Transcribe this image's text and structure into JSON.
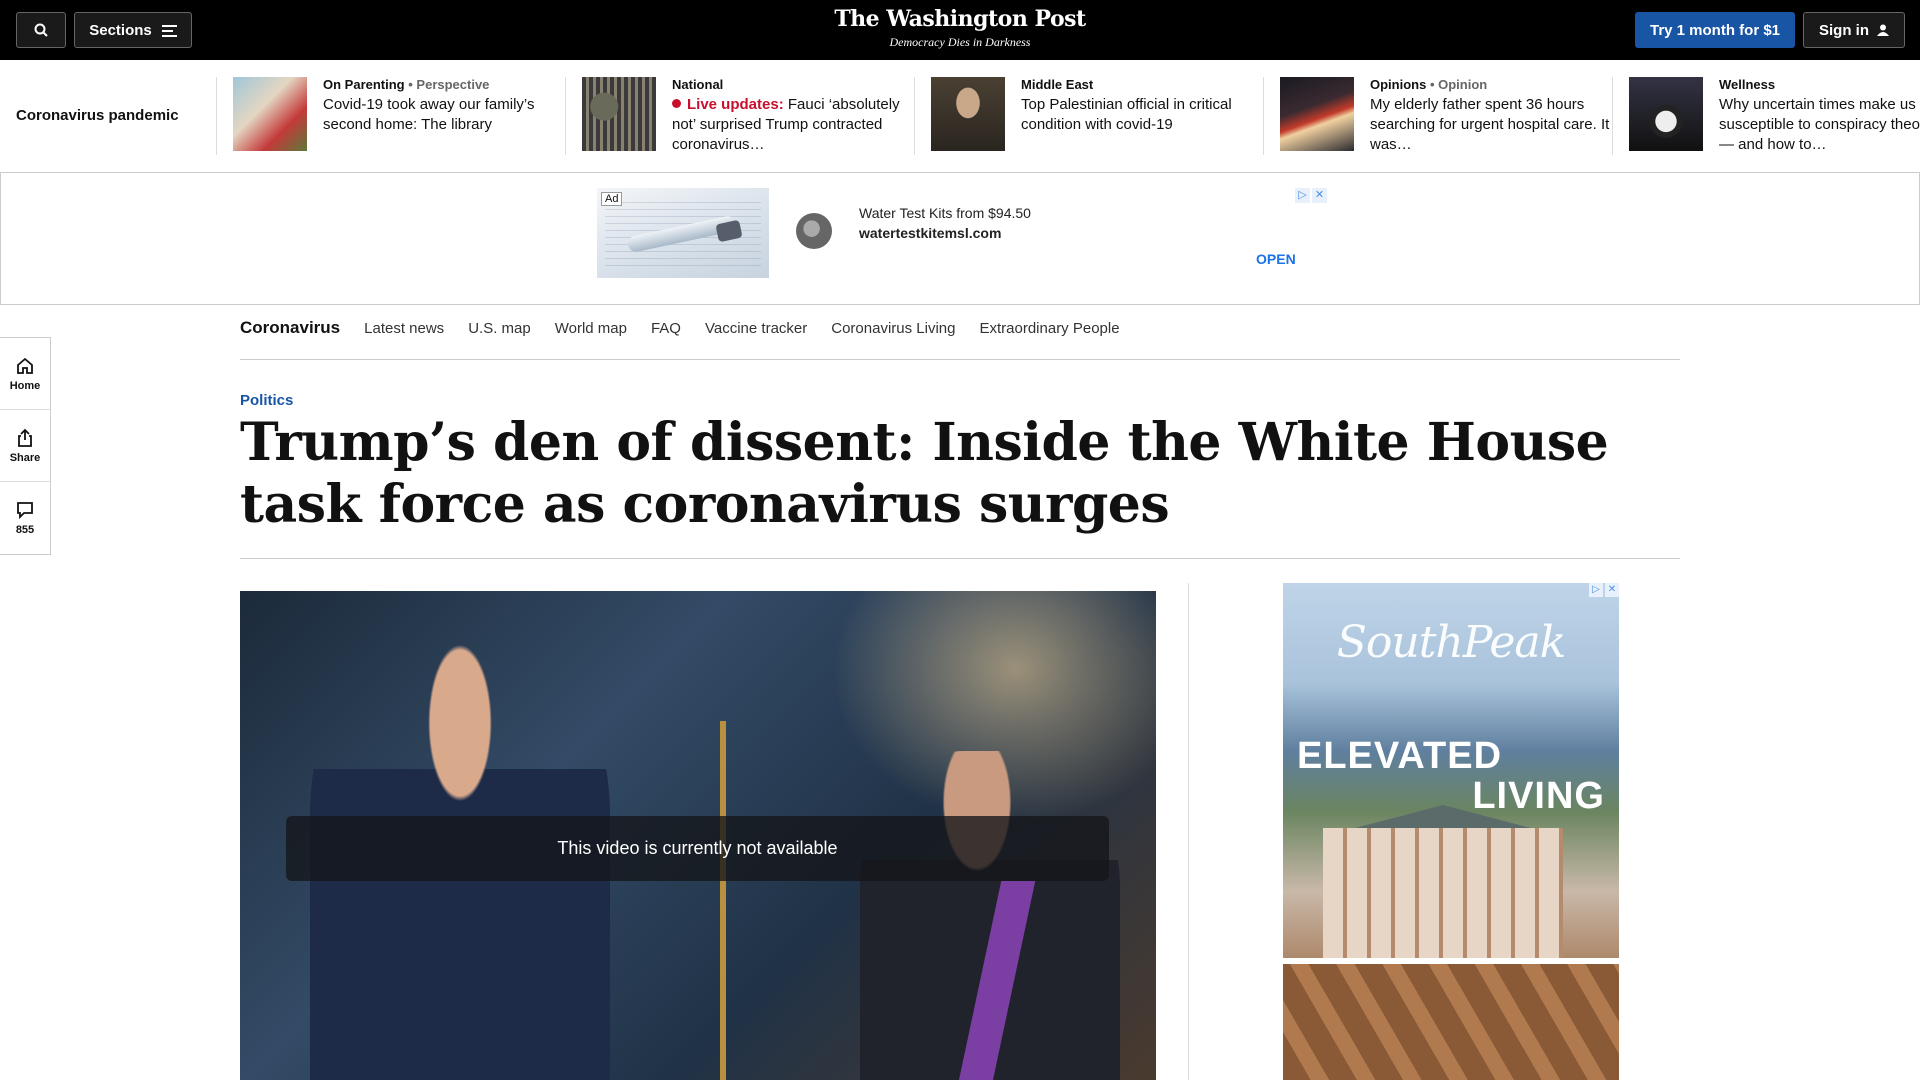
{
  "topbar": {
    "sections_label": "Sections",
    "logo": "The Washington Post",
    "tagline": "Democracy Dies in Darkness",
    "subscribe_label": "Try 1 month for $1",
    "signin_label": "Sign in"
  },
  "strip": {
    "label": "Coronavirus pandemic",
    "items": [
      {
        "kicker": "On Parenting",
        "sub": "• Perspective",
        "headline": "Covid-19 took away our family’s second home: The library",
        "live": ""
      },
      {
        "kicker": "National",
        "sub": "",
        "headline": "Fauci ‘absolutely not’ surprised Trump contracted coronavirus…",
        "live": "Live updates:"
      },
      {
        "kicker": "Middle East",
        "sub": "",
        "headline": "Top Palestinian official in critical condition with covid-19",
        "live": ""
      },
      {
        "kicker": "Opinions",
        "sub": "• Opinion",
        "headline": "My elderly father spent 36 hours searching for urgent hospital care. It was…",
        "live": ""
      },
      {
        "kicker": "Wellness",
        "sub": "",
        "headline": "Why uncertain times make us susceptible to conspiracy theories — and how to…",
        "live": ""
      }
    ]
  },
  "ad_banner": {
    "badge": "Ad",
    "title": "Water Test Kits from $94.50",
    "url": "watertestkitemsl.com",
    "cta": "OPEN"
  },
  "rail": {
    "home": "Home",
    "share": "Share",
    "comments": "855"
  },
  "secnav": {
    "title": "Coronavirus",
    "links": [
      "Latest news",
      "U.S. map",
      "World map",
      "FAQ",
      "Vaccine tracker",
      "Coronavirus Living",
      "Extraordinary People"
    ]
  },
  "article": {
    "kicker": "Politics",
    "headline": "Trump’s den of dissent: Inside the White House task force as coronavirus surges",
    "video_message": "This video is currently not available"
  },
  "side_ad": {
    "brand": "SouthPeak",
    "line1": "ELEVATED",
    "line2": "LIVING"
  },
  "colors": {
    "brand_blue": "#1955a5",
    "live_red": "#c8102e",
    "topbar_bg": "#000000"
  }
}
